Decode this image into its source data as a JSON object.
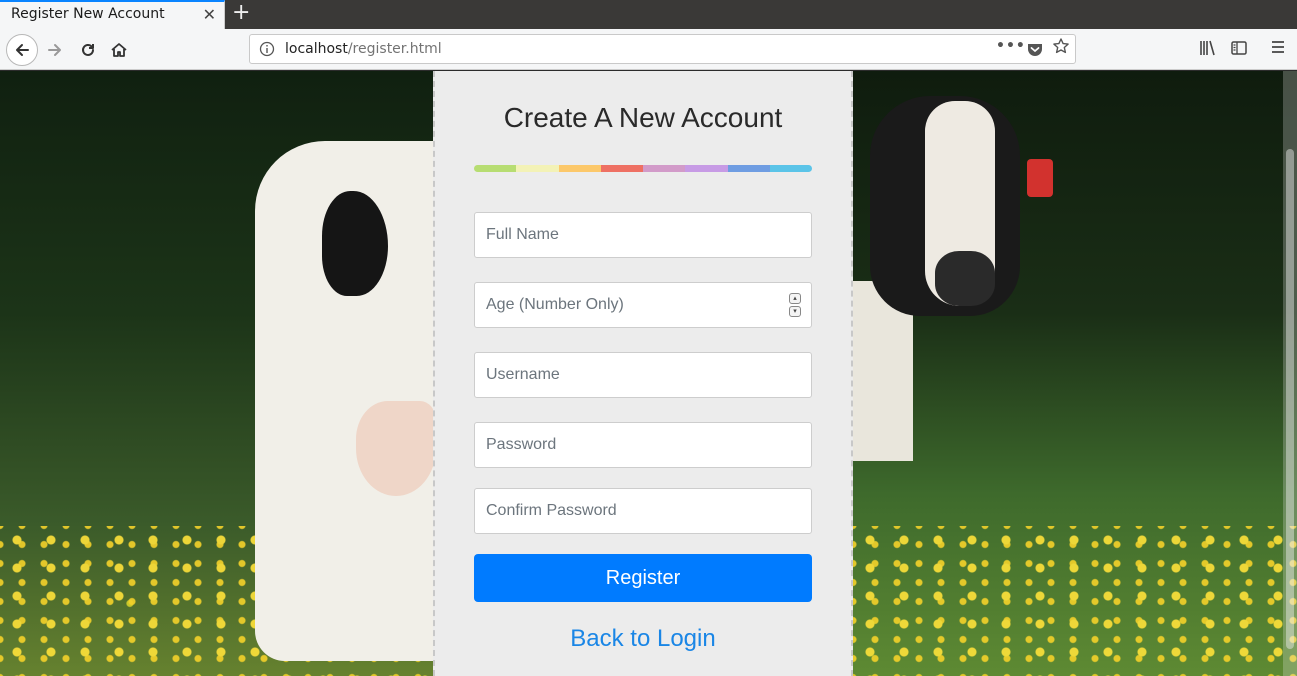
{
  "browser": {
    "tab_title": "Register New Account",
    "tab_close": "✕",
    "new_tab": "+",
    "url_host": "localhost",
    "url_path": "/register.html",
    "url_more": "•••"
  },
  "form": {
    "title": "Create A New Account",
    "rainbow_colors": [
      "#b7dd72",
      "#f3f2b6",
      "#fcc86a",
      "#ee7063",
      "#d29bc9",
      "#c79be5",
      "#6f9de2",
      "#5bc4e8"
    ],
    "fields": {
      "full_name": {
        "placeholder": "Full Name"
      },
      "age": {
        "placeholder": "Age (Number Only)"
      },
      "username": {
        "placeholder": "Username"
      },
      "password": {
        "placeholder": "Password"
      },
      "confirm_password": {
        "placeholder": "Confirm Password"
      }
    },
    "register_label": "Register",
    "back_label": "Back to Login"
  },
  "colors": {
    "accent": "#007bff",
    "link": "#1a86e6",
    "panel_bg": "#ececec"
  },
  "icons": [
    "back-icon",
    "forward-icon",
    "reload-icon",
    "home-icon",
    "info-icon",
    "pocket-icon",
    "star-icon",
    "library-icon",
    "sidebar-icon",
    "menu-icon"
  ]
}
